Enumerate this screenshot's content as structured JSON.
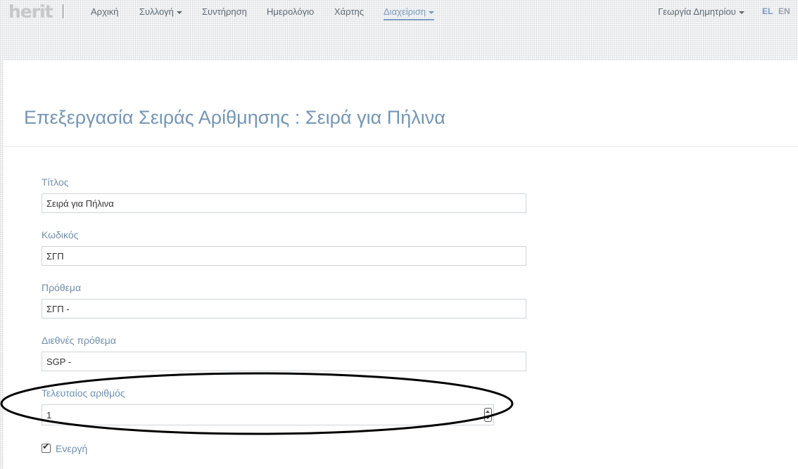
{
  "header": {
    "logo": "herit",
    "nav": [
      {
        "label": "Αρχική"
      },
      {
        "label": "Συλλογή"
      },
      {
        "label": "Συντήρηση"
      },
      {
        "label": "Ημερολόγιο"
      },
      {
        "label": "Χάρτης"
      },
      {
        "label": "Διαχείριση"
      }
    ],
    "user": "Γεωργία Δημητρίου",
    "languages": [
      "EL",
      "EN"
    ],
    "active_language": "EL"
  },
  "page": {
    "title": "Επεξεργασία Σειράς Αρίθμησης : Σειρά για Πήλινα"
  },
  "form": {
    "title_label": "Τίτλος",
    "title_value": "Σειρά για Πήλινα",
    "code_label": "Κωδικός",
    "code_value": "ΣΓΠ",
    "prefix_label": "Πρόθεμα",
    "prefix_value": "ΣΓΠ -",
    "intl_prefix_label": "Διεθνές πρόθεμα",
    "intl_prefix_value": "SGP -",
    "last_number_label": "Τελευταίος αριθμός",
    "last_number_value": "1",
    "active_label": "Ενεργή",
    "active_checked": true
  },
  "colors": {
    "accent": "#7596b4",
    "label": "#6f8fae",
    "annotation": "#000000"
  }
}
